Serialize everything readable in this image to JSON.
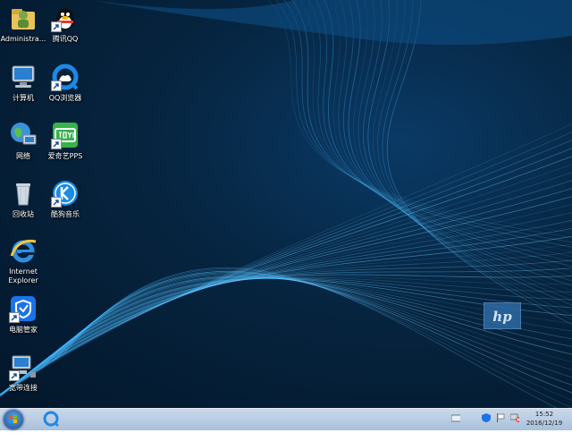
{
  "desktop_icons": [
    {
      "label": "Administra...",
      "icon": "user-folder-icon"
    },
    {
      "label": "腾讯QQ",
      "icon": "qq-penguin-icon"
    },
    {
      "label": "计算机",
      "icon": "computer-icon"
    },
    {
      "label": "QQ浏览器",
      "icon": "qq-browser-icon"
    },
    {
      "label": "网络",
      "icon": "network-icon"
    },
    {
      "label": "爱奇艺PPS",
      "icon": "iqiyi-icon"
    },
    {
      "label": "回收站",
      "icon": "recycle-bin-icon"
    },
    {
      "label": "酷狗音乐",
      "icon": "kugou-icon"
    },
    {
      "label": "Internet\nExplorer",
      "icon": "internet-explorer-icon"
    },
    {
      "label": "电脑管家",
      "icon": "pc-manager-icon"
    },
    {
      "label": "宽带连接",
      "icon": "broadband-icon"
    }
  ],
  "wallpaper": {
    "brand": "hp",
    "background_color": "#06243f"
  },
  "taskbar": {
    "clock_time": "15:52",
    "clock_date": "2016/12/19",
    "pinned": [
      "qq-browser-icon"
    ],
    "tray_icons": [
      "keyboard-icon",
      "shield-icon",
      "flag-icon",
      "network-error-icon"
    ]
  }
}
